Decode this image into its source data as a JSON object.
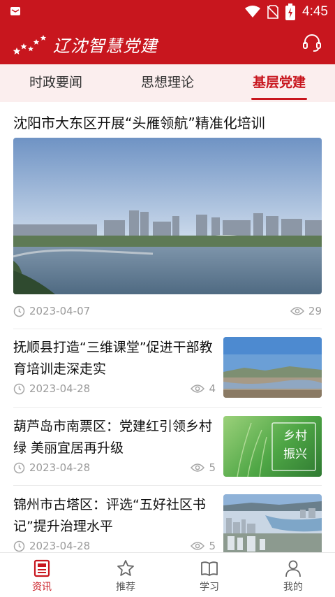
{
  "status_bar": {
    "time": "4:45"
  },
  "header": {
    "app_title": "辽沈智慧党建"
  },
  "tabs": [
    {
      "label": "时政要闻",
      "active": false
    },
    {
      "label": "思想理论",
      "active": false
    },
    {
      "label": "基层党建",
      "active": true
    }
  ],
  "feature": {
    "title": "沈阳市大东区开展“头雁领航”精准化培训",
    "date": "2023-04-07",
    "views": "29"
  },
  "articles": [
    {
      "title": "抚顺县打造“三维课堂”促进干部教育培训走深走实",
      "date": "2023-04-28",
      "views": "4"
    },
    {
      "title": "葫芦岛市南票区：党建红引领乡村绿 美丽宜居再升级",
      "date": "2023-04-28",
      "views": "5",
      "thumb_text": [
        "乡村",
        "振兴"
      ]
    },
    {
      "title": "锦州市古塔区：评选“五好社区书记”提升治理水平",
      "date": "2023-04-28",
      "views": "5"
    }
  ],
  "bottom_nav": [
    {
      "label": "资讯",
      "icon": "news-icon",
      "active": true
    },
    {
      "label": "推荐",
      "icon": "star-icon",
      "active": false
    },
    {
      "label": "学习",
      "icon": "book-icon",
      "active": false
    },
    {
      "label": "我的",
      "icon": "person-icon",
      "active": false
    }
  ],
  "colors": {
    "brand_red": "#c8161e",
    "tab_bg": "#fbeeee",
    "meta_gray": "#9a9a9a"
  }
}
